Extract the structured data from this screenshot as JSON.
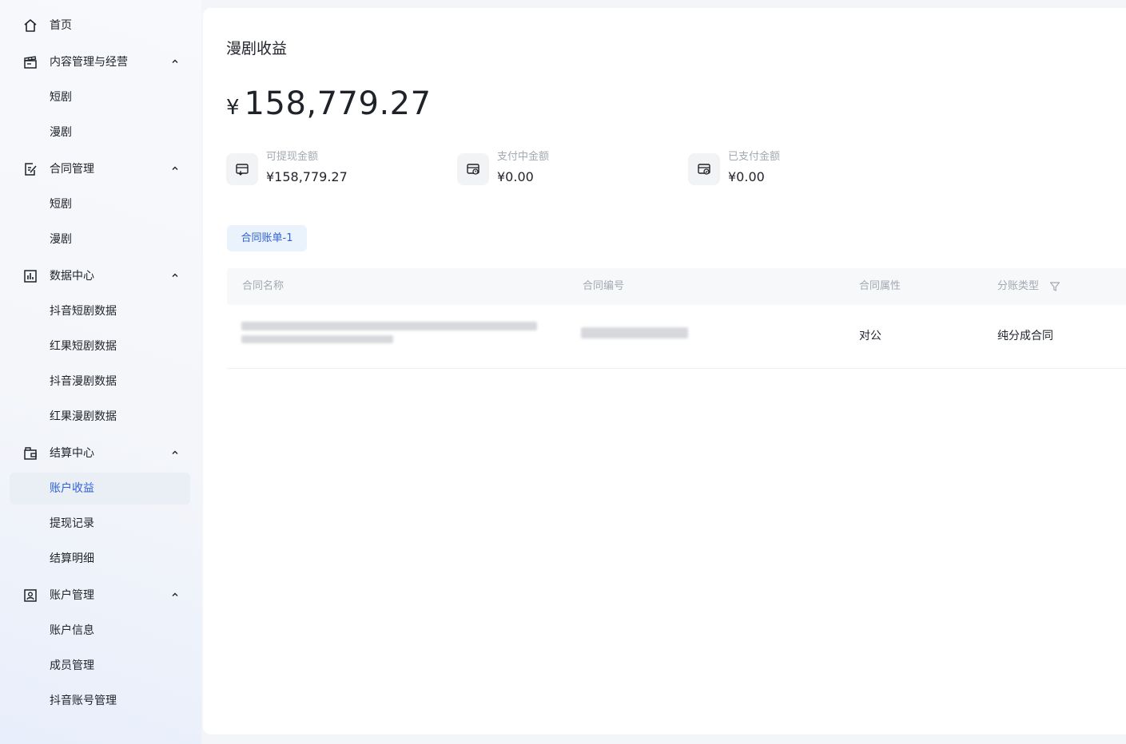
{
  "sidebar": {
    "home": {
      "label": "首页",
      "icon": "home-icon"
    },
    "groups": [
      {
        "label": "内容管理与经营",
        "icon": "clapperboard-icon",
        "items": [
          "短剧",
          "漫剧"
        ]
      },
      {
        "label": "合同管理",
        "icon": "contract-edit-icon",
        "items": [
          "短剧",
          "漫剧"
        ]
      },
      {
        "label": "数据中心",
        "icon": "bar-chart-icon",
        "items": [
          "抖音短剧数据",
          "红果短剧数据",
          "抖音漫剧数据",
          "红果漫剧数据"
        ]
      },
      {
        "label": "结算中心",
        "icon": "wallet-icon",
        "items": [
          "账户收益",
          "提现记录",
          "结算明细"
        ]
      },
      {
        "label": "账户管理",
        "icon": "account-card-icon",
        "items": [
          "账户信息",
          "成员管理",
          "抖音账号管理"
        ]
      }
    ],
    "active_item": "账户收益",
    "accent_color": "#2f62d8"
  },
  "main": {
    "title": "漫剧收益",
    "total": {
      "symbol": "¥",
      "amount": "158,779.27"
    },
    "stats": [
      {
        "label": "可提现金额",
        "value": "¥158,779.27",
        "icon": "withdraw-card-icon"
      },
      {
        "label": "支付中金额",
        "value": "¥0.00",
        "icon": "paying-card-icon"
      },
      {
        "label": "已支付金额",
        "value": "¥0.00",
        "icon": "paid-card-icon"
      }
    ],
    "tab_label": "合同账单-1",
    "table": {
      "columns": [
        "合同名称",
        "合同编号",
        "合同属性",
        "分账类型"
      ],
      "rows": [
        {
          "name": "",
          "number": "",
          "attribute": "对公",
          "split_type": "纯分成合同"
        }
      ]
    }
  }
}
